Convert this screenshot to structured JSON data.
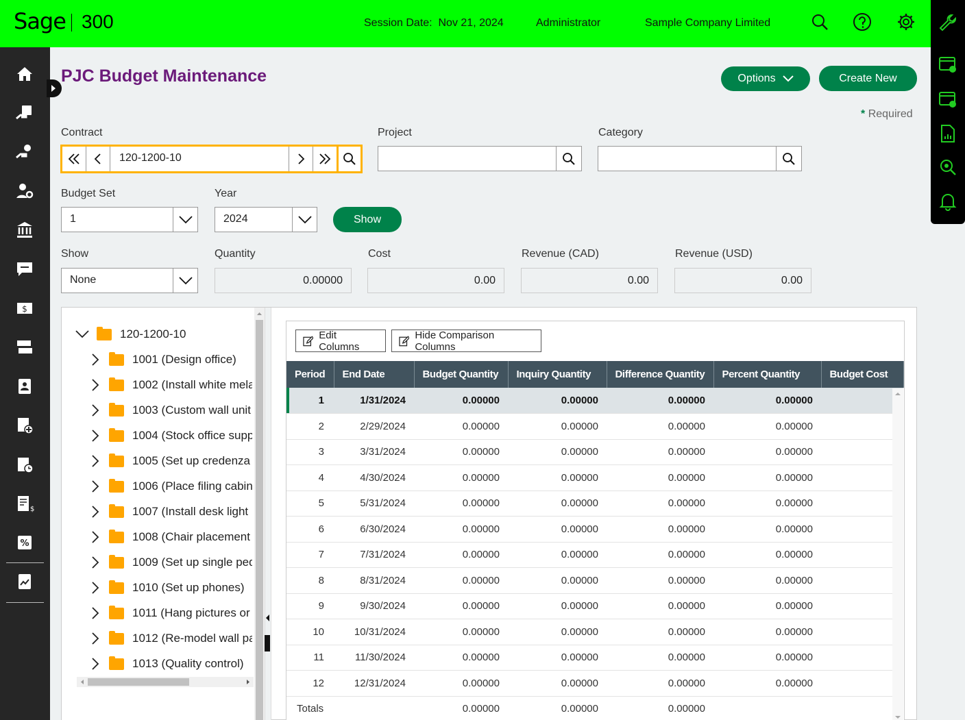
{
  "header": {
    "logo_brand": "Sage",
    "logo_product": "300",
    "session_label": "Session Date:",
    "session_date": "Nov 21, 2024",
    "user": "Administrator",
    "company": "Sample Company Limited"
  },
  "page": {
    "title": "PJC Budget Maintenance",
    "options_label": "Options",
    "create_new_label": "Create New",
    "required_star": "*",
    "required_label": "Required"
  },
  "form": {
    "contract_label": "Contract",
    "contract_value": "120-1200-10",
    "project_label": "Project",
    "project_value": "",
    "category_label": "Category",
    "category_value": "",
    "budget_set_label": "Budget Set",
    "budget_set_value": "1",
    "year_label": "Year",
    "year_value": "2024",
    "show_button": "Show",
    "show_label": "Show",
    "show_value": "None",
    "quantity_label": "Quantity",
    "quantity_value": "0.00000",
    "cost_label": "Cost",
    "cost_value": "0.00",
    "rev_cad_label": "Revenue (CAD)",
    "rev_cad_value": "0.00",
    "rev_usd_label": "Revenue (USD)",
    "rev_usd_value": "0.00"
  },
  "tree": {
    "root": "120-1200-10",
    "items": [
      "1001 (Design office)",
      "1002 (Install white mela",
      "1003 (Custom wall unit",
      "1004 (Stock office supp",
      "1005 (Set up credenza",
      "1006 (Place filing cabin",
      "1007 (Install desk light",
      "1008 (Chair placement",
      "1009 (Set up single ped",
      "1010 (Set up phones)",
      "1011 (Hang pictures or",
      "1012 (Re-model wall pa",
      "1013 (Quality control)"
    ]
  },
  "grid": {
    "edit_columns": "Edit Columns",
    "hide_comparison": "Hide Comparison Columns",
    "columns": [
      "Period",
      "End Date",
      "Budget Quantity",
      "Inquiry Quantity",
      "Difference Quantity",
      "Percent Quantity",
      "Budget Cost"
    ],
    "rows": [
      [
        "1",
        "1/31/2024",
        "0.00000",
        "0.00000",
        "0.00000",
        "0.00000",
        ""
      ],
      [
        "2",
        "2/29/2024",
        "0.00000",
        "0.00000",
        "0.00000",
        "0.00000",
        ""
      ],
      [
        "3",
        "3/31/2024",
        "0.00000",
        "0.00000",
        "0.00000",
        "0.00000",
        ""
      ],
      [
        "4",
        "4/30/2024",
        "0.00000",
        "0.00000",
        "0.00000",
        "0.00000",
        ""
      ],
      [
        "5",
        "5/31/2024",
        "0.00000",
        "0.00000",
        "0.00000",
        "0.00000",
        ""
      ],
      [
        "6",
        "6/30/2024",
        "0.00000",
        "0.00000",
        "0.00000",
        "0.00000",
        ""
      ],
      [
        "7",
        "7/31/2024",
        "0.00000",
        "0.00000",
        "0.00000",
        "0.00000",
        ""
      ],
      [
        "8",
        "8/31/2024",
        "0.00000",
        "0.00000",
        "0.00000",
        "0.00000",
        ""
      ],
      [
        "9",
        "9/30/2024",
        "0.00000",
        "0.00000",
        "0.00000",
        "0.00000",
        ""
      ],
      [
        "10",
        "10/31/2024",
        "0.00000",
        "0.00000",
        "0.00000",
        "0.00000",
        ""
      ],
      [
        "11",
        "11/30/2024",
        "0.00000",
        "0.00000",
        "0.00000",
        "0.00000",
        ""
      ],
      [
        "12",
        "12/31/2024",
        "0.00000",
        "0.00000",
        "0.00000",
        "0.00000",
        ""
      ]
    ],
    "totals_label": "Totals",
    "totals": [
      "0.00000",
      "0.00000",
      "0.00000"
    ]
  },
  "icons": {
    "left_nav": [
      "home-icon",
      "invoice-hand-icon",
      "hand-money-icon",
      "user-settings-icon",
      "bank-icon",
      "chat-money-icon",
      "cash-icon",
      "transfer-icon",
      "contact-card-icon",
      "document-add-icon",
      "clipboard-clock-icon",
      "ledger-dollar-icon",
      "percent-icon",
      "report-chart-icon"
    ],
    "right_dock": [
      "wrench-icon",
      "calendar-window-icon",
      "calendar-add-icon",
      "report-icon",
      "search-eye-icon",
      "bell-icon"
    ]
  },
  "colors": {
    "topbar": "#00ff00",
    "accent": "#00824a",
    "title": "#6b1a7a",
    "highlight": "#ffb300",
    "grid_header": "#41535e"
  }
}
